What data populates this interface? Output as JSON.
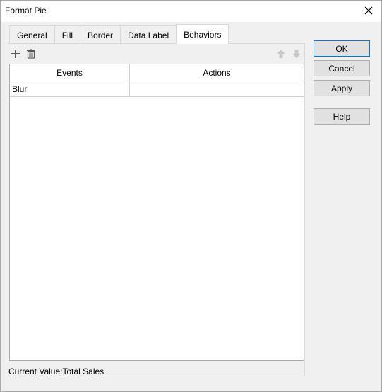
{
  "window": {
    "title": "Format Pie"
  },
  "tabs": [
    {
      "label": "General",
      "active": false
    },
    {
      "label": "Fill",
      "active": false
    },
    {
      "label": "Border",
      "active": false
    },
    {
      "label": "Data Label",
      "active": false
    },
    {
      "label": "Behaviors",
      "active": true
    }
  ],
  "toolbar": {
    "add_icon": "plus-icon",
    "delete_icon": "trash-icon",
    "move_up_icon": "arrow-up-icon",
    "move_down_icon": "arrow-down-icon"
  },
  "grid": {
    "columns": [
      "Events",
      "Actions"
    ],
    "rows": [
      {
        "event": "Blur",
        "action": ""
      }
    ]
  },
  "status": {
    "current_value": "Current Value:Total Sales"
  },
  "buttons": {
    "ok": "OK",
    "cancel": "Cancel",
    "apply": "Apply",
    "help": "Help"
  },
  "colors": {
    "accent": "#0078d7",
    "disabled_arrow": "#c8c8c8",
    "icon": "#5a5a5a"
  }
}
